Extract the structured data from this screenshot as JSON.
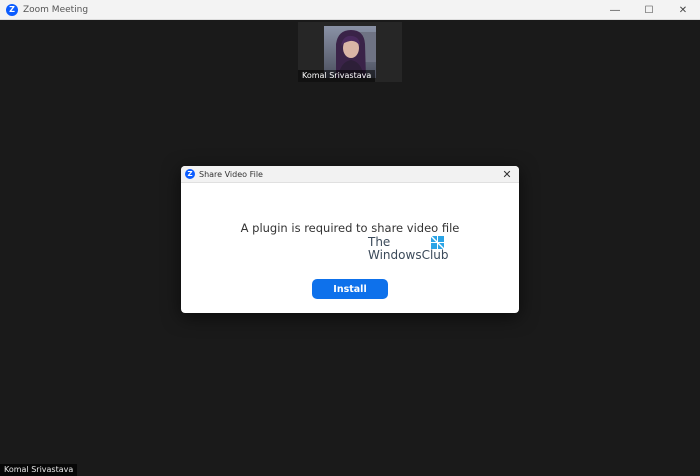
{
  "window": {
    "title": "Zoom Meeting",
    "logo_letter": "Z",
    "controls": {
      "minimize": "—",
      "maximize": "☐",
      "close": "✕"
    }
  },
  "participant": {
    "name": "Komal Srivastava"
  },
  "self_view": {
    "name": "Komal Srivastava"
  },
  "dialog": {
    "title": "Share Video File",
    "logo_letter": "Z",
    "close_glyph": "✕",
    "message": "A plugin is required to share video file",
    "install_label": "Install",
    "watermark_line1": "The",
    "watermark_line2": "WindowsClub"
  },
  "colors": {
    "accent": "#0E71EB",
    "zoom_logo": "#0B5CFF",
    "meeting_bg": "#1A1A1A"
  }
}
